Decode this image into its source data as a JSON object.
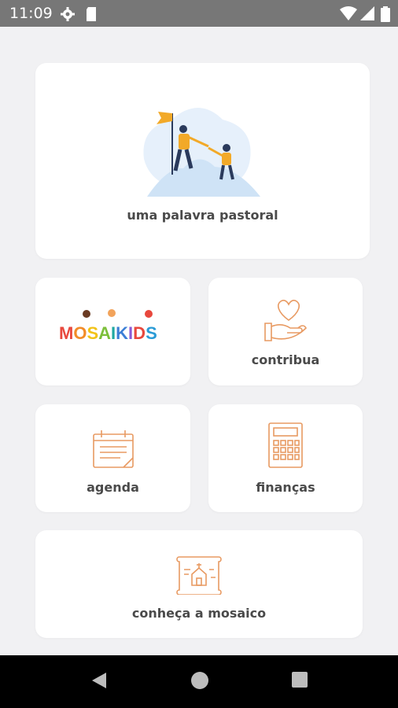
{
  "status_bar": {
    "time": "11:09"
  },
  "cards": {
    "pastoral": {
      "label": "uma palavra pastoral"
    },
    "mosaikids": {
      "logo_text": "MOSAIKIDS"
    },
    "contribua": {
      "label": "contribua"
    },
    "agenda": {
      "label": "agenda"
    },
    "financas": {
      "label": "finanças"
    },
    "conheca": {
      "label": "conheça a mosaico"
    }
  },
  "colors": {
    "accent": "#e89a62",
    "label": "#4a4a4a",
    "statusbar": "#777777"
  }
}
